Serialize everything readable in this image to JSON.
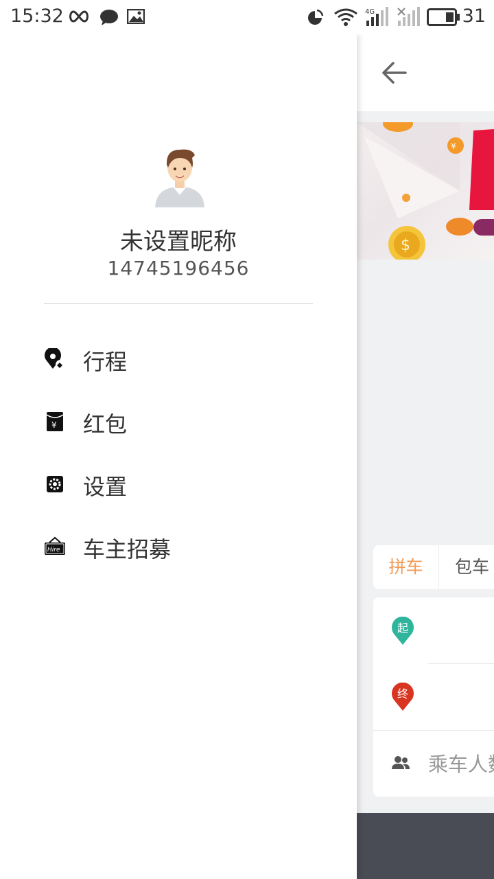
{
  "status_bar": {
    "time": "15:32",
    "battery_level": "31",
    "icons": [
      "infinity-icon",
      "chat-bubble-icon",
      "image-icon",
      "nfc-icon",
      "wifi-icon",
      "signal-4g-icon",
      "signal-icon",
      "battery-icon"
    ]
  },
  "drawer": {
    "nickname": "未设置昵称",
    "phone": "14745196456",
    "menu": [
      {
        "label": "行程",
        "icon": "location-pin-icon"
      },
      {
        "label": "红包",
        "icon": "red-envelope-icon"
      },
      {
        "label": "设置",
        "icon": "gear-icon"
      },
      {
        "label": "车主招募",
        "icon": "hire-sign-icon"
      }
    ]
  },
  "main": {
    "tabs": [
      {
        "label": "拼车",
        "active": true
      },
      {
        "label": "包车",
        "active": false
      }
    ],
    "start_marker": "起",
    "end_marker": "终",
    "passengers_placeholder": "乘车人数"
  },
  "colors": {
    "accent_orange": "#f29a55",
    "start_green": "#2fb59b",
    "end_red": "#d9341f",
    "bottom_bar": "#4a4c55",
    "page_bg": "#f0f1f3"
  }
}
